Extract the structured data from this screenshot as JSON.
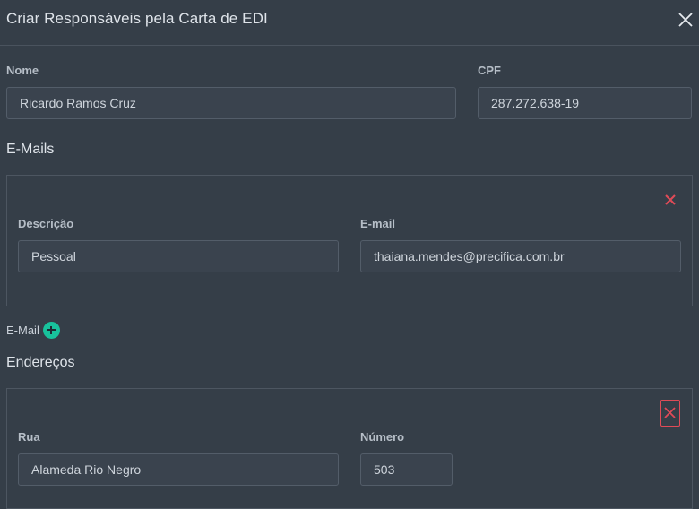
{
  "dialog": {
    "title": "Criar Responsáveis pela Carta de EDI"
  },
  "form": {
    "nome_label": "Nome",
    "nome_value": "Ricardo Ramos Cruz",
    "cpf_label": "CPF",
    "cpf_value": "287.272.638-19"
  },
  "emails": {
    "section_title": "E-Mails",
    "items": [
      {
        "descricao_label": "Descrição",
        "descricao_value": "Pessoal",
        "email_label": "E-mail",
        "email_value": "thaiana.mendes@precifica.com.br"
      }
    ],
    "add_label": "E-Mail"
  },
  "enderecos": {
    "section_title": "Endereços",
    "items": [
      {
        "rua_label": "Rua",
        "rua_value": "Alameda Rio Negro",
        "numero_label": "Número",
        "numero_value": "503"
      }
    ]
  },
  "colors": {
    "background": "#353e48",
    "accent_green": "#18c29c",
    "danger_red": "#e04b57"
  },
  "icons": {
    "close": "close-icon",
    "remove": "remove-x-icon",
    "add": "plus-circle-icon"
  }
}
